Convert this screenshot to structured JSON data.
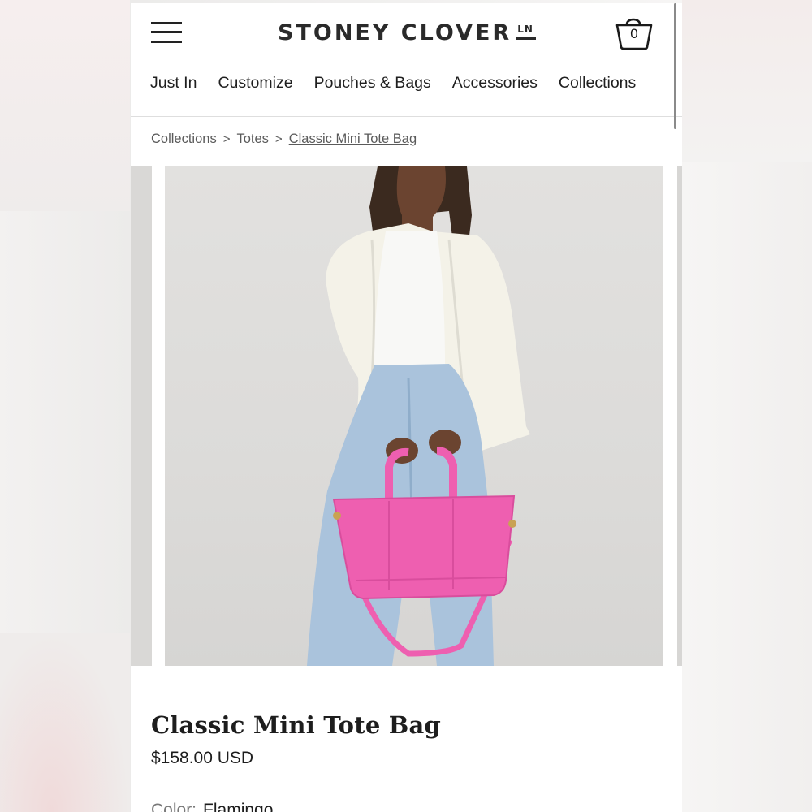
{
  "header": {
    "brand": "STONEY CLOVER",
    "brand_mark": "LN",
    "cart_count": "0"
  },
  "nav": {
    "items": [
      "Just In",
      "Customize",
      "Pouches & Bags",
      "Accessories",
      "Collections"
    ]
  },
  "breadcrumb": {
    "items": [
      "Collections",
      "Totes",
      "Classic Mini Tote Bag"
    ],
    "separator": ">"
  },
  "product": {
    "title": "Classic Mini Tote Bag",
    "price": "$158.00 USD",
    "color_label": "Color:",
    "color_value": "Flamingo",
    "bag_color": "#ee5fb0"
  },
  "icons": {
    "menu": "hamburger-menu-icon",
    "cart": "shopping-bag-icon"
  }
}
